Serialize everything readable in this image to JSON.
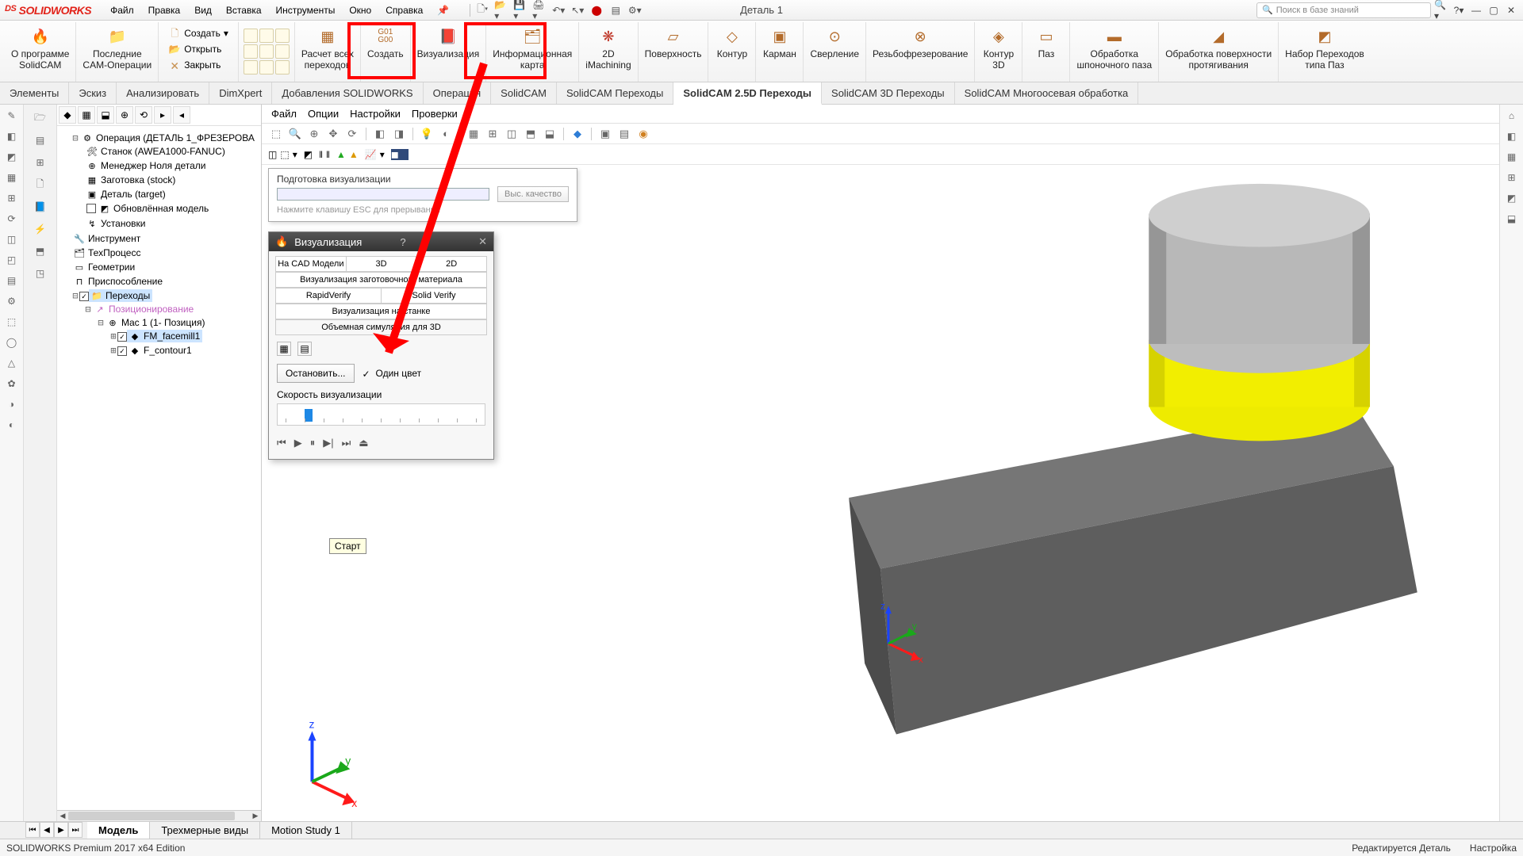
{
  "app": {
    "name": "SOLIDWORKS",
    "doc_title": "Деталь 1"
  },
  "search": {
    "placeholder": "Поиск в базе знаний"
  },
  "menu": [
    "Файл",
    "Правка",
    "Вид",
    "Вставка",
    "Инструменты",
    "Окно",
    "Справка"
  ],
  "ribbon": {
    "items": [
      {
        "label": "О программе\nSolidCAM"
      },
      {
        "label": "Последние\nCAM-Операции"
      },
      {
        "label": "Расчет всех\nпереходов"
      },
      {
        "label": "Создать"
      },
      {
        "label": "Визуализация"
      },
      {
        "label": "Информационная\nкарта"
      },
      {
        "label": "2D\niMachining"
      },
      {
        "label": "Поверхность"
      },
      {
        "label": "Контур"
      },
      {
        "label": "Карман"
      },
      {
        "label": "Сверление"
      },
      {
        "label": "Резьбофрезерование"
      },
      {
        "label": "Контур\n3D"
      },
      {
        "label": "Паз"
      },
      {
        "label": "Обработка\nшпоночного паза"
      },
      {
        "label": "Обработка поверхности\nпротягивания"
      },
      {
        "label": "Набор Переходов\nтипа Паз"
      }
    ],
    "file_ops": {
      "create": "Создать",
      "open": "Открыть",
      "close": "Закрыть"
    }
  },
  "tabs": [
    "Элементы",
    "Эскиз",
    "Анализировать",
    "DimXpert",
    "Добавления SOLIDWORKS",
    "Операция",
    "SolidCAM",
    "SolidCAM Переходы",
    "SolidCAM 2.5D Переходы",
    "SolidCAM 3D Переходы",
    "SolidCAM Многоосевая обработка"
  ],
  "tabs_active": 8,
  "tree": {
    "root": "Операция (ДЕТАЛЬ 1_ФРЕЗЕРОВА",
    "nodes": [
      "Станок (AWEA1000-FANUC)",
      "Менеджер Ноля детали",
      "Заготовка (stock)",
      "Деталь (target)",
      "Обновлённая модель",
      "Установки"
    ],
    "groups": [
      "Инструмент",
      "ТехПроцесс",
      "Геометрии",
      "Приспособление",
      "Переходы"
    ],
    "pos": "Позиционирование",
    "mac": "Mac 1 (1- Позиция)",
    "ops": [
      "FM_facemill1",
      "F_contour1"
    ]
  },
  "vp_menu": [
    "Файл",
    "Опции",
    "Настройки",
    "Проверки"
  ],
  "prep": {
    "title": "Подготовка визуализации",
    "btn": "Выс. качество",
    "hint": "Нажмите клавишу ESC для прерывания"
  },
  "sim": {
    "title": "Визуализация",
    "help": "?",
    "tabs_row1": [
      "На  CAD Модели",
      "3D",
      "2D"
    ],
    "tabs_row2_a": "Визуализация заготовочного материала",
    "tabs_row3": [
      "RapidVerify",
      "Solid Verify"
    ],
    "tabs_row4": "Визуализация на станке",
    "tabs_row5": "Объемная симуляция для 3D",
    "stop": "Остановить...",
    "one_color": "Один цвет",
    "speed_label": "Скорость визуализации",
    "tooltip": "Старт"
  },
  "bottom_tabs": [
    "Модель",
    "Трехмерные виды",
    "Motion Study 1"
  ],
  "bottom_active": 0,
  "status": {
    "left": "SOLIDWORKS Premium 2017 x64 Edition",
    "right1": "Редактируется Деталь",
    "right2": "Настройка"
  }
}
